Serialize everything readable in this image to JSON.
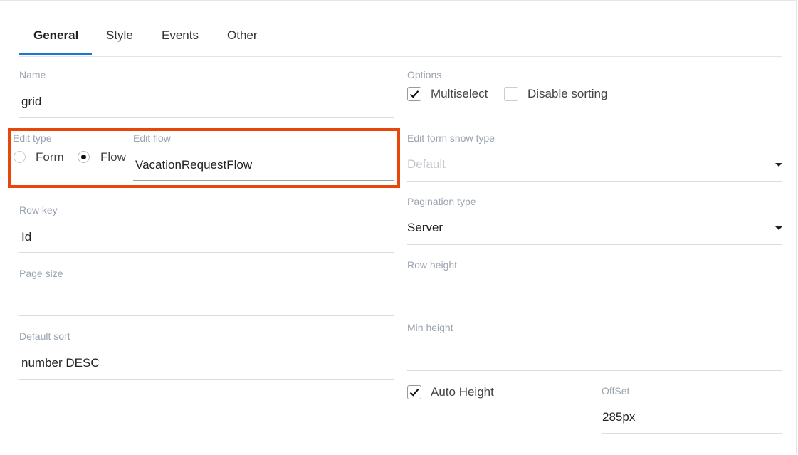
{
  "tabs": [
    {
      "label": "General",
      "active": true
    },
    {
      "label": "Style",
      "active": false
    },
    {
      "label": "Events",
      "active": false
    },
    {
      "label": "Other",
      "active": false
    }
  ],
  "left": {
    "name": {
      "label": "Name",
      "value": "grid"
    },
    "edit_type": {
      "label": "Edit type",
      "options": [
        "Form",
        "Flow"
      ],
      "selected": "Flow"
    },
    "edit_flow": {
      "label": "Edit flow",
      "value": "VacationRequestFlow"
    },
    "row_key": {
      "label": "Row key",
      "value": "Id"
    },
    "page_size": {
      "label": "Page size",
      "value": ""
    },
    "default_sort": {
      "label": "Default sort",
      "value": "number DESC"
    }
  },
  "right": {
    "options": {
      "label": "Options",
      "multiselect": {
        "label": "Multiselect",
        "checked": true
      },
      "disable_sorting": {
        "label": "Disable sorting",
        "checked": false
      }
    },
    "edit_form_show_type": {
      "label": "Edit form show type",
      "placeholder": "Default"
    },
    "pagination_type": {
      "label": "Pagination type",
      "value": "Server"
    },
    "row_height": {
      "label": "Row height",
      "value": ""
    },
    "min_height": {
      "label": "Min height",
      "value": ""
    },
    "auto_height": {
      "label": "Auto Height",
      "checked": true
    },
    "offset": {
      "label": "OffSet",
      "value": "285px"
    }
  },
  "colors": {
    "accent": "#1976d2",
    "highlight": "#e8470c",
    "label": "#9aa3b0"
  }
}
